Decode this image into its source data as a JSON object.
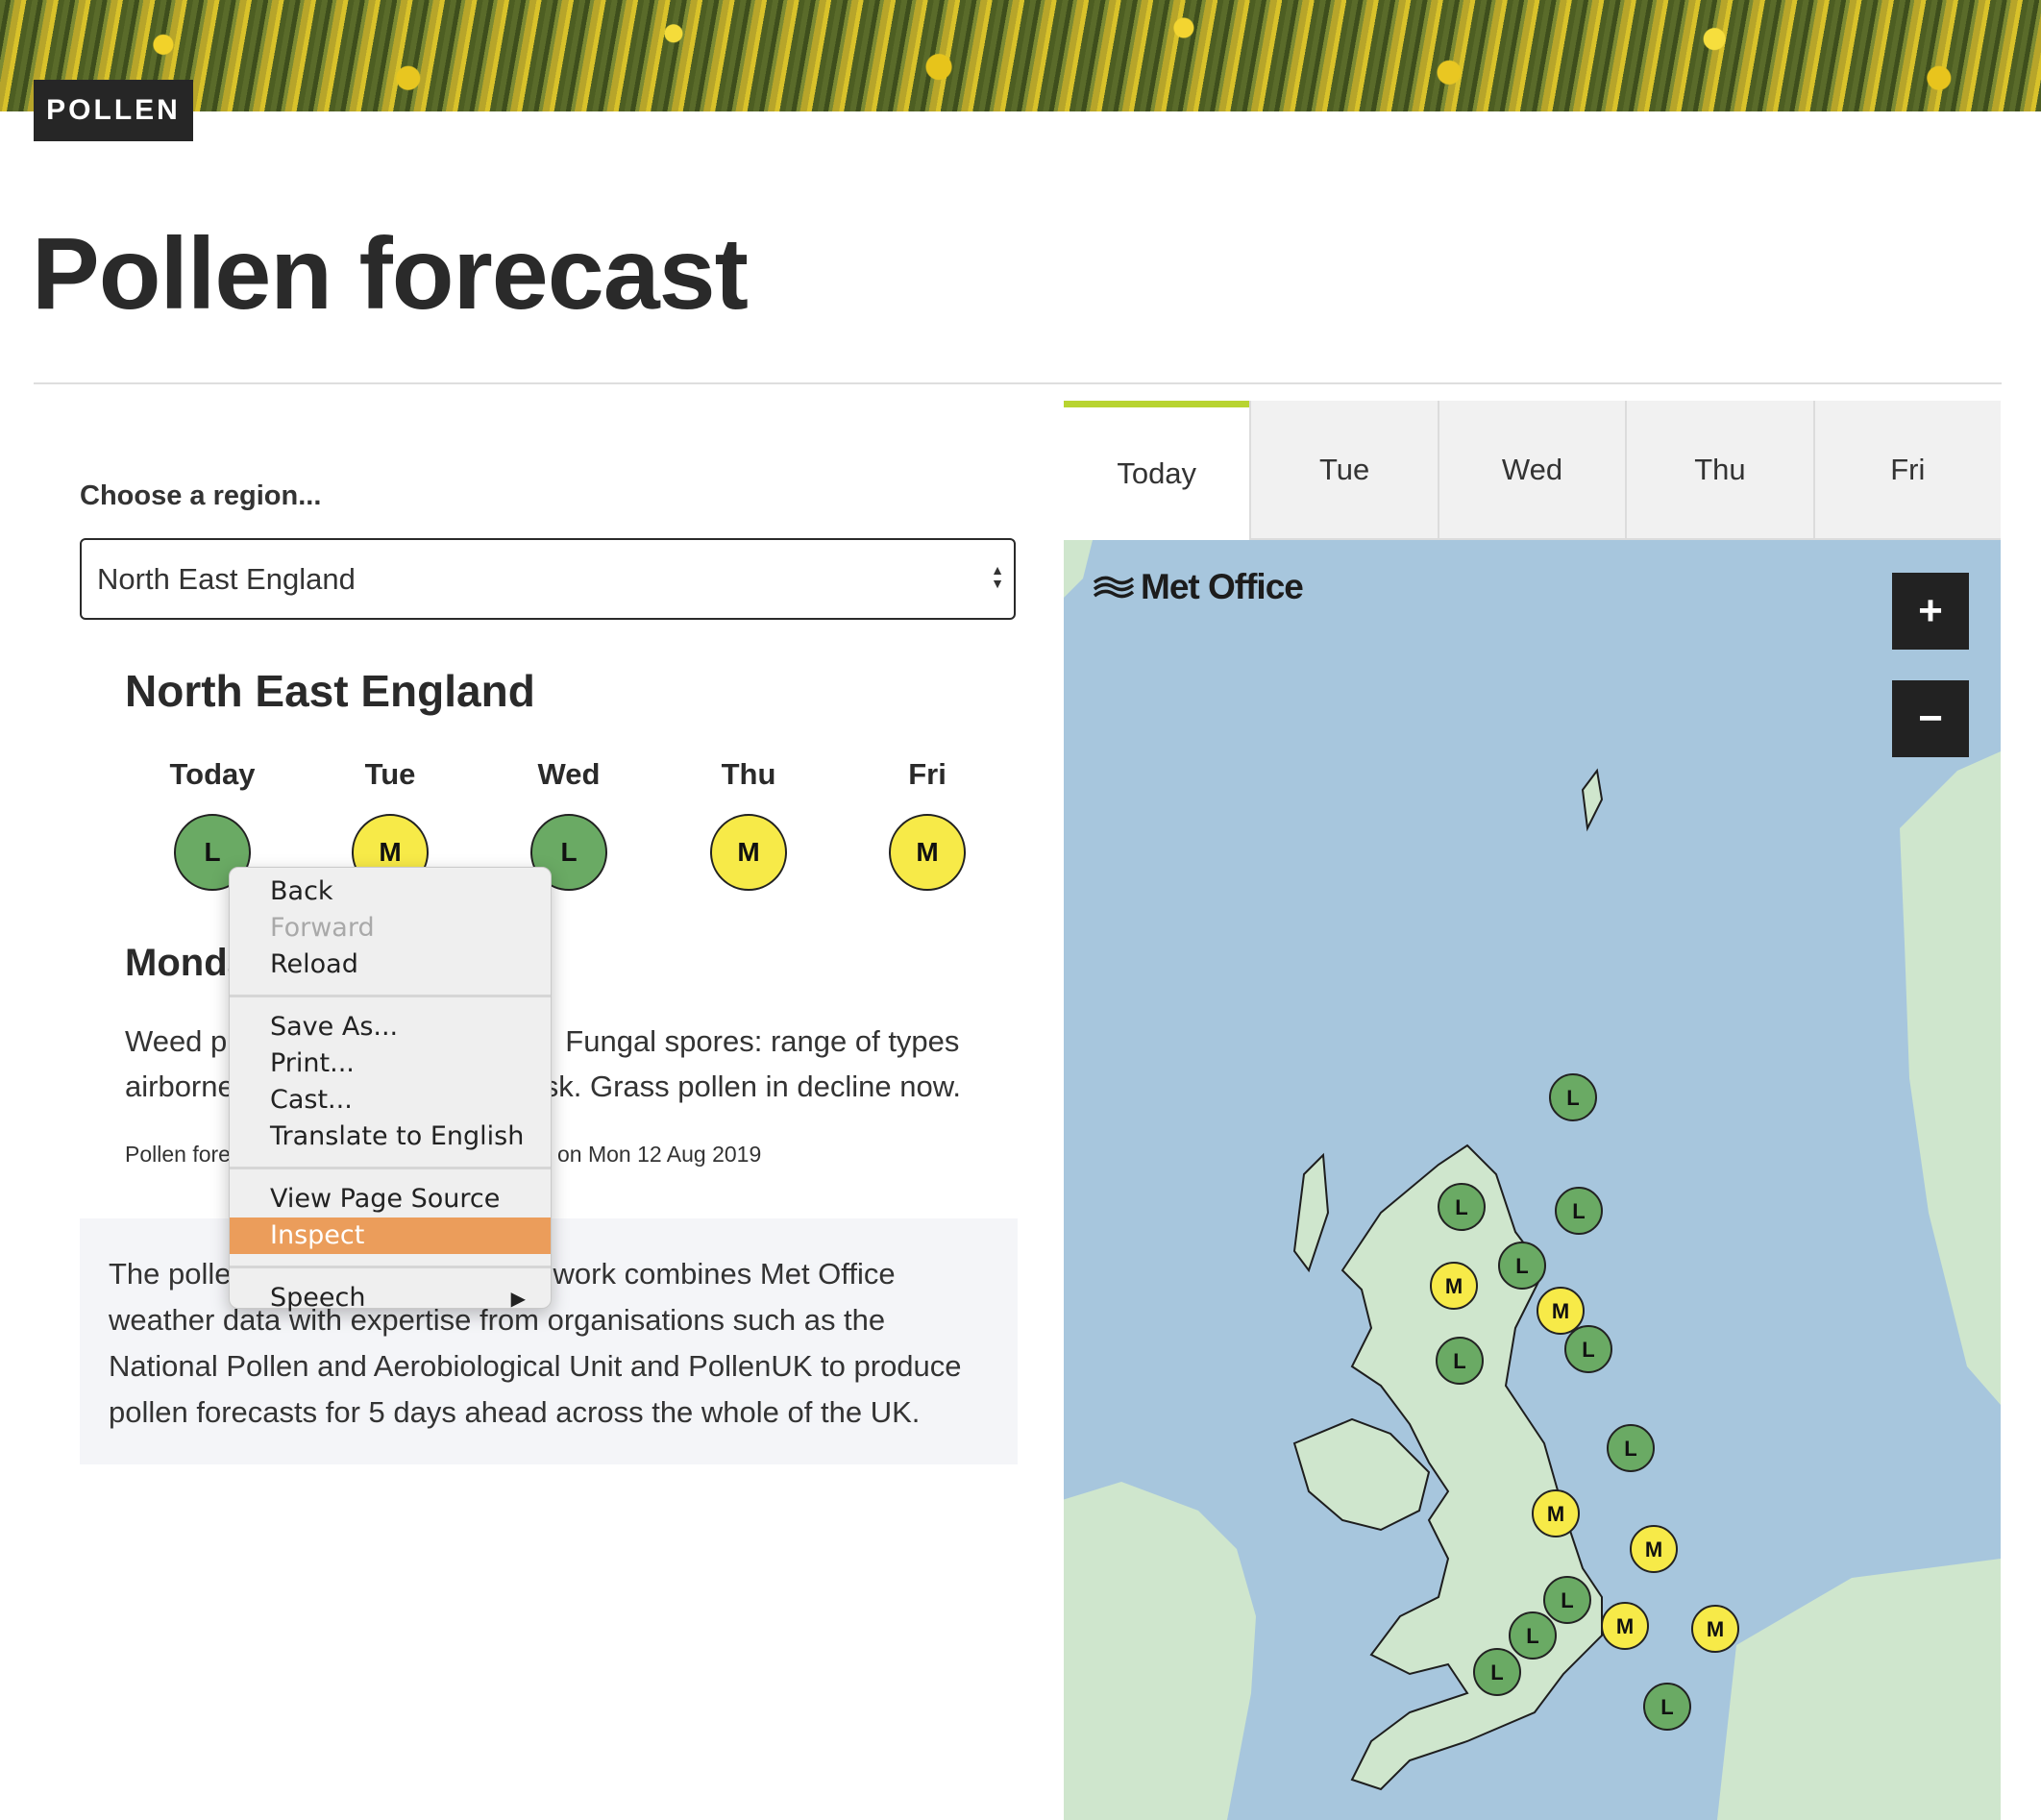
{
  "section_badge": "POLLEN",
  "page_title": "Pollen forecast",
  "region_select": {
    "label": "Choose a region...",
    "value": "North East England"
  },
  "region_name": "North East England",
  "days": [
    {
      "name": "Today",
      "level": "L"
    },
    {
      "name": "Tue",
      "level": "M"
    },
    {
      "name": "Wed",
      "level": "L"
    },
    {
      "name": "Thu",
      "level": "M"
    },
    {
      "name": "Fri",
      "level": "M"
    }
  ],
  "forecast": {
    "heading": "Monda",
    "line1_start": "Weed p",
    "line1_end": "Fungal spores: range of types",
    "line2_start": "airborne",
    "line2_end": "sk. Grass pollen in decline now.",
    "issued_start": "Pollen fore",
    "issued_end": "on Mon 12 Aug 2019"
  },
  "info": {
    "line1_start": "The polle",
    "line1_end": "work combines Met Office",
    "line2": "weather data with expertise from organisations such as the",
    "line3": "National Pollen and Aerobiological Unit and PollenUK to produce",
    "line4": "pollen forecasts for 5 days ahead across the whole of the UK."
  },
  "map": {
    "tabs": [
      "Today",
      "Tue",
      "Wed",
      "Thu",
      "Fri"
    ],
    "active_tab": "Today",
    "logo": "Met Office",
    "zoom_in": "+",
    "zoom_out": "−",
    "markers": [
      "L",
      "L",
      "L",
      "M",
      "L",
      "M",
      "L",
      "L",
      "L",
      "M",
      "M",
      "L",
      "M",
      "M",
      "L",
      "L",
      "L"
    ],
    "colors": {
      "sea": "#a7c6dd",
      "land": "#cfe6cd",
      "low": "#6aaa64",
      "moderate": "#f7ea48"
    }
  },
  "context_menu": {
    "items": [
      "Back",
      "Forward",
      "Reload",
      "Save As...",
      "Print...",
      "Cast...",
      "Translate to English",
      "View Page Source",
      "Inspect",
      "Speech"
    ],
    "disabled": [
      "Forward"
    ],
    "highlighted": "Inspect"
  }
}
